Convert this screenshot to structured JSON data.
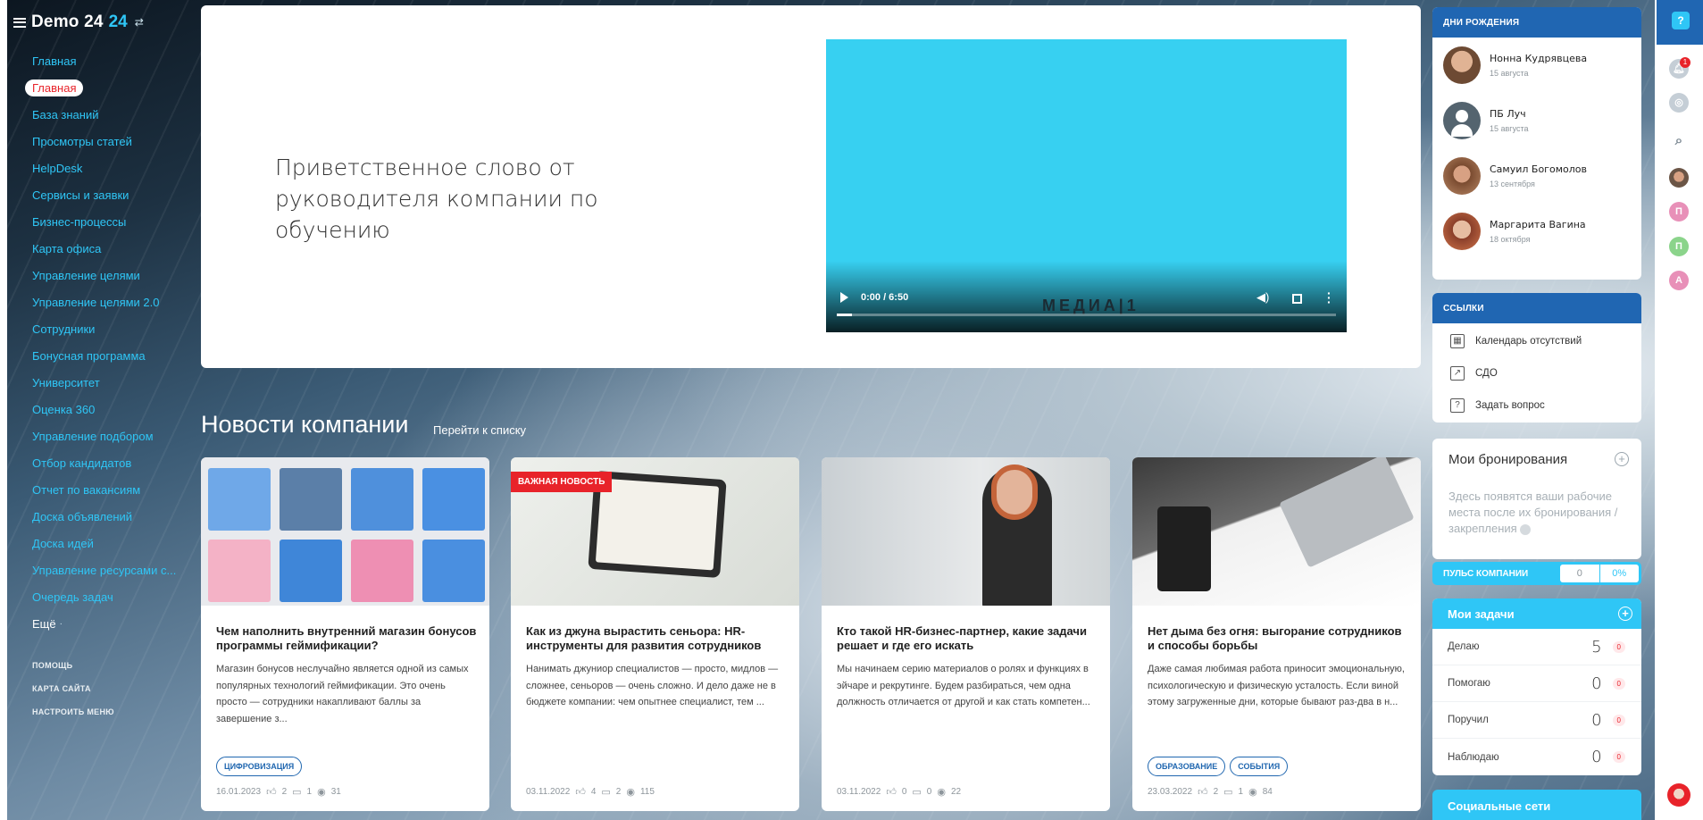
{
  "app": {
    "name": "Demo 24",
    "name_accent": "24",
    "switch_glyph": "⇄"
  },
  "sidebar": {
    "items": [
      {
        "label": "Главная",
        "active": false
      },
      {
        "label": "Главная",
        "active": true
      },
      {
        "label": "База знаний"
      },
      {
        "label": "Просмотры статей"
      },
      {
        "label": "HelpDesk"
      },
      {
        "label": "Сервисы и заявки"
      },
      {
        "label": "Бизнес-процессы"
      },
      {
        "label": "Карта офиса"
      },
      {
        "label": "Управление целями"
      },
      {
        "label": "Управление целями 2.0"
      },
      {
        "label": "Сотрудники"
      },
      {
        "label": "Бонусная программа"
      },
      {
        "label": "Университет"
      },
      {
        "label": "Оценка 360"
      },
      {
        "label": "Управление подбором"
      },
      {
        "label": "Отбор кандидатов"
      },
      {
        "label": "Отчет по вакансиям"
      },
      {
        "label": "Доска объявлений"
      },
      {
        "label": "Доска идей"
      },
      {
        "label": "Управление ресурсами с..."
      },
      {
        "label": "Очередь задач"
      }
    ],
    "more_label": "Ещё",
    "more_glyph": "·",
    "system_links": [
      "ПОМОЩЬ",
      "КАРТА САЙТА",
      "НАСТРОИТЬ МЕНЮ"
    ]
  },
  "hero": {
    "title": "Приветственное слово от руководителя компании по обучению",
    "video": {
      "time": "0:00 / 6:50",
      "watermark": "МЕДИА|1",
      "progress": 0.03
    }
  },
  "news": {
    "title": "Новости компании",
    "list_link": "Перейти к списку",
    "cards": [
      {
        "title": "Чем наполнить внутренний магазин бонусов программы геймификации?",
        "text": "Магазин бонусов неслучайно является одной из самых популярных технологий геймификации. Это очень просто — сотрудники накапливают баллы за завершение з...",
        "tags": [
          "ЦИФРОВИЗАЦИЯ"
        ],
        "date": "16.01.2023",
        "likes": "2",
        "comments": "1",
        "views": "31",
        "badge": ""
      },
      {
        "title": "Как из джуна вырастить сеньора: HR-инструменты для развития сотрудников",
        "text": "Нанимать джуниор специалистов — просто, мидлов — сложнее, сеньоров — очень сложно. И дело даже не в бюджете компании: чем опытнее специалист, тем ...",
        "tags": [],
        "date": "03.11.2022",
        "likes": "4",
        "comments": "2",
        "views": "115",
        "badge": "ВАЖНАЯ НОВОСТЬ"
      },
      {
        "title": "Кто такой HR-бизнес-партнер, какие задачи решает и где его искать",
        "text": "Мы начинаем серию материалов о ролях и функциях в эйчаре и рекрутинге. Будем разбираться, чем одна должность отличается от другой и как стать компетен...",
        "tags": [],
        "date": "03.11.2022",
        "likes": "0",
        "comments": "0",
        "views": "22",
        "badge": ""
      },
      {
        "title": "Нет дыма без огня: выгорание сотрудников и способы борьбы",
        "text": "Даже самая любимая работа приносит эмоциональную, психологическую и физическую усталость. Если виной этому загруженные дни, которые бывают раз-два в н...",
        "tags": [
          "ОБРАЗОВАНИЕ",
          "СОБЫТИЯ"
        ],
        "date": "23.03.2022",
        "likes": "2",
        "comments": "1",
        "views": "84",
        "badge": ""
      }
    ]
  },
  "birthdays": {
    "title": "ДНИ РОЖДЕНИЯ",
    "people": [
      {
        "name": "Нонна Кудрявцева",
        "date": "15 августа"
      },
      {
        "name": "ПБ Луч",
        "date": "15 августа"
      },
      {
        "name": "Самуил Богомолов",
        "date": "13 сентября"
      },
      {
        "name": "Маргарита Вагина",
        "date": "18 октября"
      }
    ]
  },
  "links": {
    "title": "ССЫЛКИ",
    "items": [
      {
        "label": "Календарь отсутствий",
        "icon": "calendar-icon"
      },
      {
        "label": "СДО",
        "icon": "external-link-icon"
      },
      {
        "label": "Задать вопрос",
        "icon": "question-icon"
      }
    ]
  },
  "bookings": {
    "title": "Мои бронирования",
    "empty_text": "Здесь появятся ваши рабочие места после их бронирования / закрепления"
  },
  "pulse": {
    "label": "ПУЛЬС КОМПАНИИ",
    "value": "0",
    "percent": "0%"
  },
  "tasks": {
    "title": "Мои задачи",
    "rows": [
      {
        "label": "Делаю",
        "count": "5",
        "badge": "0"
      },
      {
        "label": "Помогаю",
        "count": "0",
        "badge": "0"
      },
      {
        "label": "Поручил",
        "count": "0",
        "badge": "0"
      },
      {
        "label": "Наблюдаю",
        "count": "0",
        "badge": "0"
      }
    ]
  },
  "social": {
    "title": "Социальные сети"
  },
  "rightbar": {
    "help": "?",
    "notifications_count": "1",
    "users": [
      "П",
      "П",
      "А"
    ]
  },
  "colors": {
    "accent": "#2fc6f6",
    "brand": "#2066b2",
    "danger": "#e8232a"
  }
}
